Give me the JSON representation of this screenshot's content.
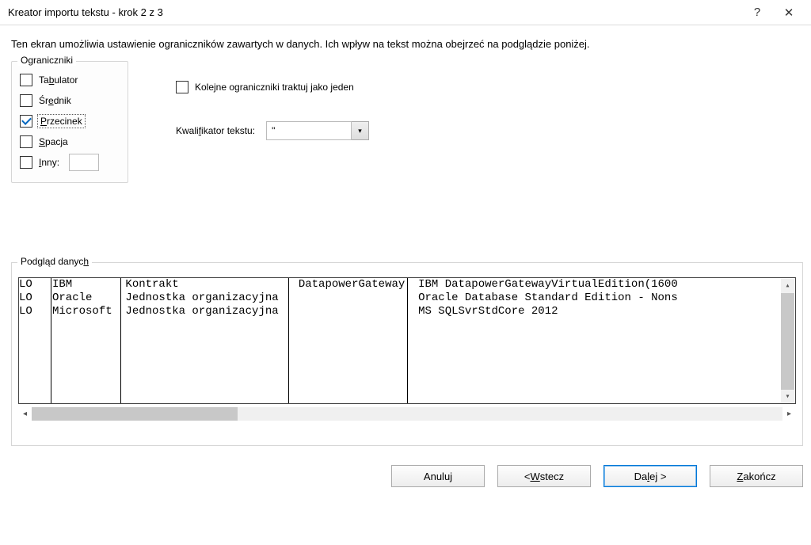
{
  "title": "Kreator importu tekstu - krok 2 z 3",
  "help_symbol": "?",
  "close_symbol": "✕",
  "instruction": "Ten ekran umożliwia ustawienie ograniczników zawartych w danych. Ich wpływ na tekst można obejrzeć na podglądzie poniżej.",
  "delimiters": {
    "legend": "Ograniczniki",
    "tab_pre": "Ta",
    "tab_u": "b",
    "tab_post": "ulator",
    "tab_checked": false,
    "semicolon_pre": "Śr",
    "semicolon_u": "e",
    "semicolon_post": "dnik",
    "semicolon_checked": false,
    "comma_pre": "",
    "comma_u": "P",
    "comma_post": "rzecinek",
    "comma_checked": true,
    "space_pre": "",
    "space_u": "S",
    "space_post": "pacja",
    "space_checked": false,
    "other_pre": "",
    "other_u": "I",
    "other_post": "nny:",
    "other_checked": false,
    "other_value": ""
  },
  "consecutive": {
    "label": "Kolejne ograniczniki traktuj jako jeden",
    "checked": false
  },
  "qualifier": {
    "label_pre": "Kwali",
    "label_u": "f",
    "label_post": "ikator tekstu:",
    "value": "\""
  },
  "preview": {
    "legend_pre": "Podgląd danyc",
    "legend_u": "h",
    "text": "LO   IBM        Kontrakt                  DatapowerGateway  IBM DatapowerGatewayVirtualEdition(1600\nLO   Oracle     Jednostka organizacyjna                     Oracle Database Standard Edition - Nons\nLO   Microsoft  Jednostka organizacyjna                     MS SQLSvrStdCore 2012"
  },
  "buttons": {
    "cancel": "Anuluj",
    "back_pre": "< ",
    "back_u": "W",
    "back_post": "stecz",
    "next_pre": "Da",
    "next_u": "l",
    "next_post": "ej >",
    "finish_pre": "",
    "finish_u": "Z",
    "finish_post": "akończ"
  }
}
